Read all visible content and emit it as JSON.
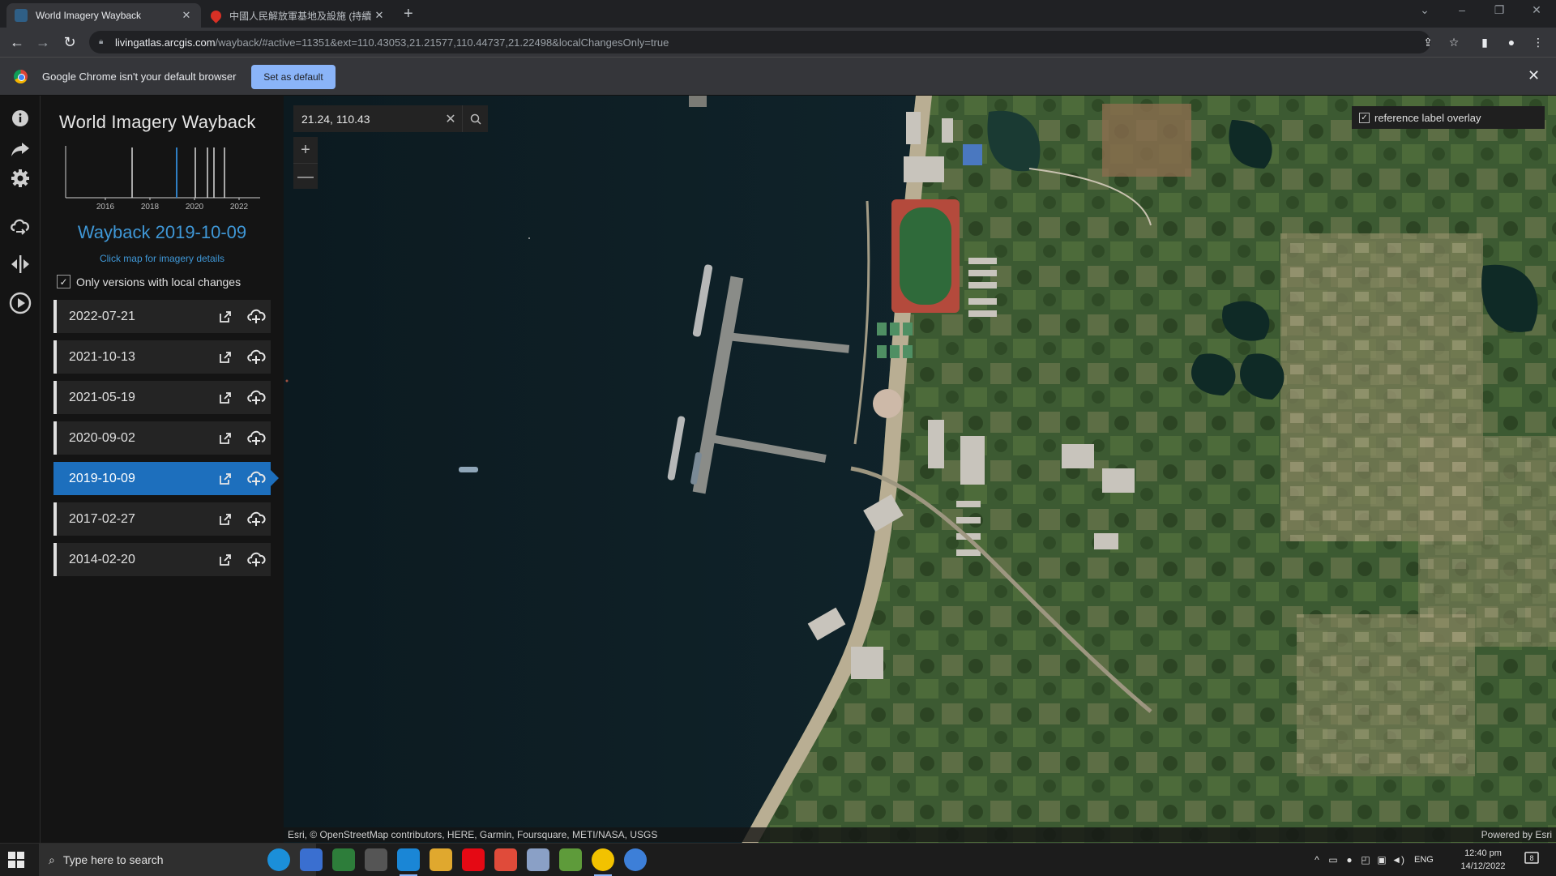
{
  "browser": {
    "tabs": [
      {
        "title": "World Imagery Wayback",
        "active": true
      },
      {
        "title": "中國人民解放軍基地及設施 (持續",
        "active": false
      }
    ],
    "new_tab": "+",
    "url_host": "livingatlas.arcgis.com",
    "url_path": "/wayback/#active=11351&ext=110.43053,21.21577,110.44737,21.22498&localChangesOnly=true",
    "infobar": {
      "message": "Google Chrome isn't your default browser",
      "button": "Set as default"
    }
  },
  "app": {
    "title": "World Imagery Wayback",
    "timeline": {
      "tick_labels": [
        "2016",
        "2018",
        "2020",
        "2022"
      ]
    },
    "current_release": "Wayback 2019-10-09",
    "click_hint": "Click map for imagery details",
    "local_changes_label": "Only versions with local changes",
    "local_changes_checked": true,
    "releases": [
      {
        "date": "2022-07-21"
      },
      {
        "date": "2021-10-13"
      },
      {
        "date": "2021-05-19"
      },
      {
        "date": "2020-09-02"
      },
      {
        "date": "2019-10-09",
        "active": true
      },
      {
        "date": "2017-02-27"
      },
      {
        "date": "2014-02-20"
      }
    ],
    "rail_icons": [
      "info-icon",
      "share-icon",
      "settings-icon",
      "swipe-cloud-icon",
      "swipe-compare-icon",
      "play-icon"
    ]
  },
  "map": {
    "search_value": "21.24, 110.43",
    "zoom_in": "+",
    "zoom_out": "—",
    "reference_overlay_label": "reference label overlay",
    "attribution": "Esri, © OpenStreetMap contributors, HERE, Garmin, Foursquare, METI/NASA, USGS",
    "powered_by": "Powered by Esri"
  },
  "taskbar": {
    "search_placeholder": "Type here to search",
    "language": "ENG",
    "time": "12:40 pm",
    "date": "14/12/2022",
    "notification_count": "8",
    "apps": [
      "edge-icon",
      "store-icon",
      "terminal-icon",
      "files-icon",
      "skype-icon",
      "explorer-icon",
      "netflix-icon",
      "app-icon",
      "settings-app-icon",
      "minecraft-icon",
      "chrome-icon",
      "earth-icon"
    ]
  },
  "colors": {
    "accent": "#1d6fbd",
    "accent_text": "#3f97d6",
    "panel_bg": "#141414",
    "water": "#0f1d23"
  }
}
